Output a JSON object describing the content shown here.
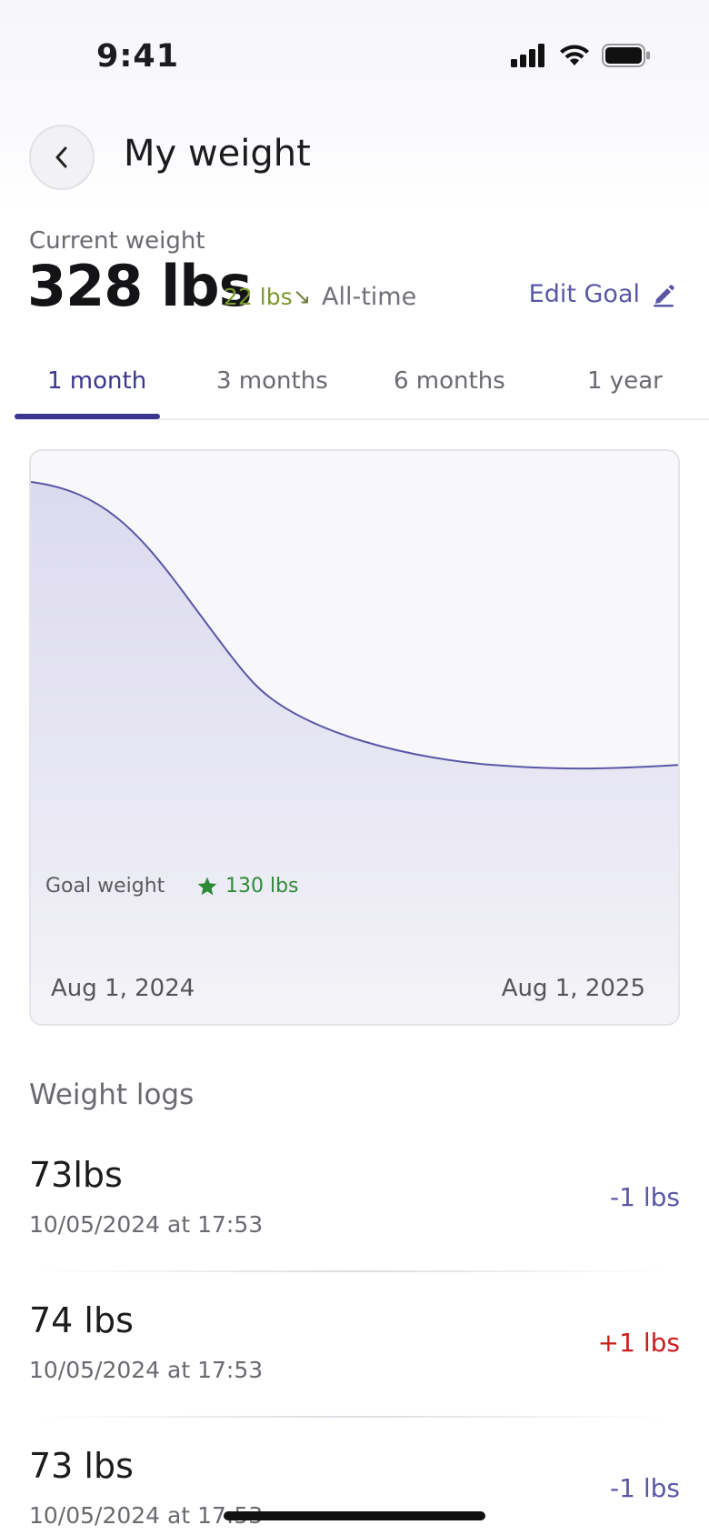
{
  "status_bar": {
    "time": "9:41"
  },
  "header": {
    "title": "My weight"
  },
  "current_weight": {
    "label": "Current weight",
    "value": "328 lbs",
    "delta": "22 lbs",
    "delta_arrow": "↘",
    "delta_period": "All-time",
    "edit_goal_label": "Edit Goal"
  },
  "tabs": [
    {
      "label": "1 month",
      "active": true
    },
    {
      "label": "3 months",
      "active": false
    },
    {
      "label": "6 months",
      "active": false
    },
    {
      "label": "1 year",
      "active": false
    }
  ],
  "chart": {
    "goal_label": "Goal weight",
    "goal_value": "130 lbs",
    "start_date": "Aug 1, 2024",
    "end_date": "Aug 1, 2025"
  },
  "colors": {
    "accent": "#3c3690",
    "line": "#5b57a6",
    "goal": "#2c8a36",
    "positive_change": "#cc1d1d",
    "negative_change": "#5b57a6"
  },
  "logs": {
    "title": "Weight logs",
    "items": [
      {
        "weight": "73lbs",
        "date": "10/05/2024 at 17:53",
        "change": "-1 lbs",
        "direction": "down"
      },
      {
        "weight": "74 lbs",
        "date": "10/05/2024 at 17:53",
        "change": "+1 lbs",
        "direction": "up"
      },
      {
        "weight": "73 lbs",
        "date": "10/05/2024 at 17:53",
        "change": "-1 lbs",
        "direction": "down"
      }
    ]
  }
}
